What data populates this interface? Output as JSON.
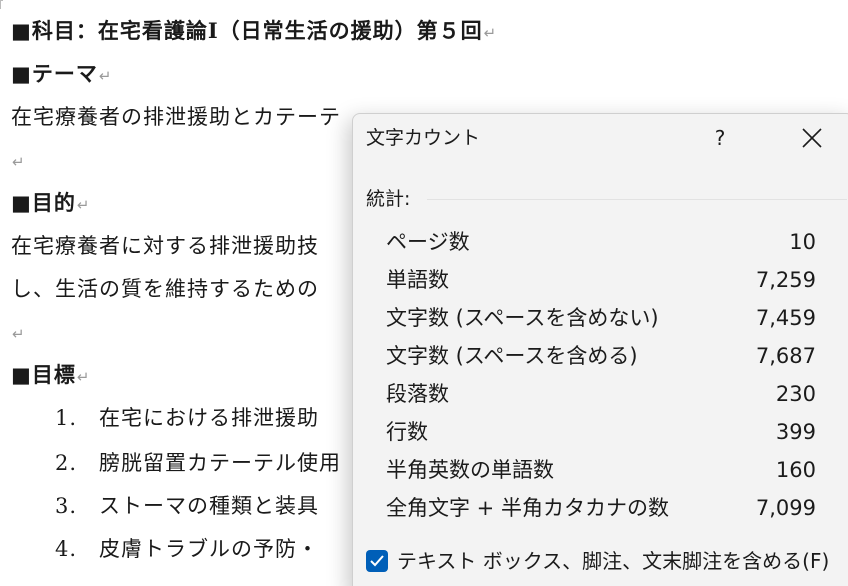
{
  "document": {
    "lines": [
      {
        "text": "■科目：在宅看護論Ⅰ（日常生活の援助）第５回",
        "bold": true
      },
      {
        "text": "■テーマ",
        "bold": true
      },
      {
        "text": "在宅療養者の排泄援助とカテーテ",
        "bold": false
      },
      {
        "text": "",
        "bold": false
      },
      {
        "text": "■目的",
        "bold": true
      },
      {
        "text": "在宅療養者に対する排泄援助技",
        "bold": false
      },
      {
        "text": "し、生活の質を維持するための",
        "bold": false
      },
      {
        "text": "",
        "bold": false
      },
      {
        "text": "■目標",
        "bold": true
      }
    ],
    "list_items": [
      {
        "num": "1.",
        "text": "在宅における排泄援助"
      },
      {
        "num": "2.",
        "text": "膀胱留置カテーテル使用"
      },
      {
        "num": "3.",
        "text": "ストーマの種類と装具"
      },
      {
        "num": "4.",
        "text": "皮膚トラブルの予防・"
      }
    ],
    "paragraph_mark": "↵"
  },
  "dialog": {
    "title": "文字カウント",
    "help_label": "?",
    "close_icon": "close-icon",
    "section_label": "統計:",
    "stats": [
      {
        "label": "ページ数",
        "value": "10"
      },
      {
        "label": "単語数",
        "value": "7,259"
      },
      {
        "label": "文字数 (スペースを含めない)",
        "value": "7,459"
      },
      {
        "label": "文字数 (スペースを含める)",
        "value": "7,687"
      },
      {
        "label": "段落数",
        "value": "230"
      },
      {
        "label": "行数",
        "value": "399"
      },
      {
        "label": "半角英数の単語数",
        "value": "160"
      },
      {
        "label": "全角文字 + 半角カタカナの数",
        "value": "7,099"
      }
    ],
    "checkbox": {
      "label": "テキスト ボックス、脚注、文末脚注を含める(F)",
      "checked": true
    },
    "accent_color": "#005fb8"
  }
}
